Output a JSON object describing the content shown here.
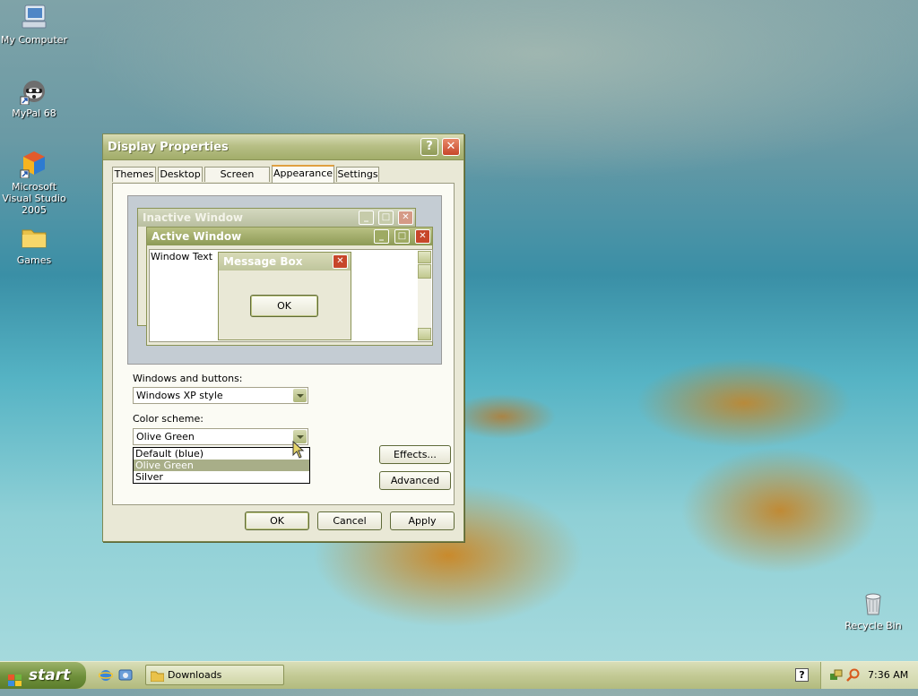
{
  "desktop": {
    "icons": [
      {
        "label": "My Computer",
        "icon": "computer-icon"
      },
      {
        "label": "MyPal 68",
        "icon": "raccoon-browser-icon"
      },
      {
        "label": "Microsoft Visual Studio 2005",
        "icon": "visual-studio-icon"
      },
      {
        "label": "Games",
        "icon": "folder-icon"
      },
      {
        "label": "Recycle Bin",
        "icon": "recycle-bin-icon"
      }
    ]
  },
  "dialog": {
    "title": "Display Properties",
    "help_label": "?",
    "close_label": "✕",
    "tabs": [
      {
        "label": "Themes"
      },
      {
        "label": "Desktop"
      },
      {
        "label": "Screen Saver"
      },
      {
        "label": "Appearance",
        "active": true
      },
      {
        "label": "Settings"
      }
    ],
    "preview": {
      "inactive_title": "Inactive Window",
      "active_title": "Active Window",
      "window_text": "Window Text",
      "message_title": "Message Box",
      "message_ok": "OK"
    },
    "windows_buttons_label": "Windows and buttons:",
    "windows_buttons_value": "Windows XP style",
    "color_scheme_label": "Color scheme:",
    "color_scheme_value": "Olive Green",
    "color_scheme_options": [
      {
        "label": "Default (blue)"
      },
      {
        "label": "Olive Green",
        "selected": true
      },
      {
        "label": "Silver"
      }
    ],
    "effects_label": "Effects...",
    "advanced_label": "Advanced",
    "ok_label": "OK",
    "cancel_label": "Cancel",
    "apply_label": "Apply"
  },
  "taskbar": {
    "start_label": "start",
    "task_label": "Downloads",
    "clock": "7:36 AM"
  },
  "colors": {
    "olive_title": "#a2ad6a",
    "active_title": "#8d9a56",
    "close_red": "#c7462a",
    "selection": "#a8ae88"
  }
}
